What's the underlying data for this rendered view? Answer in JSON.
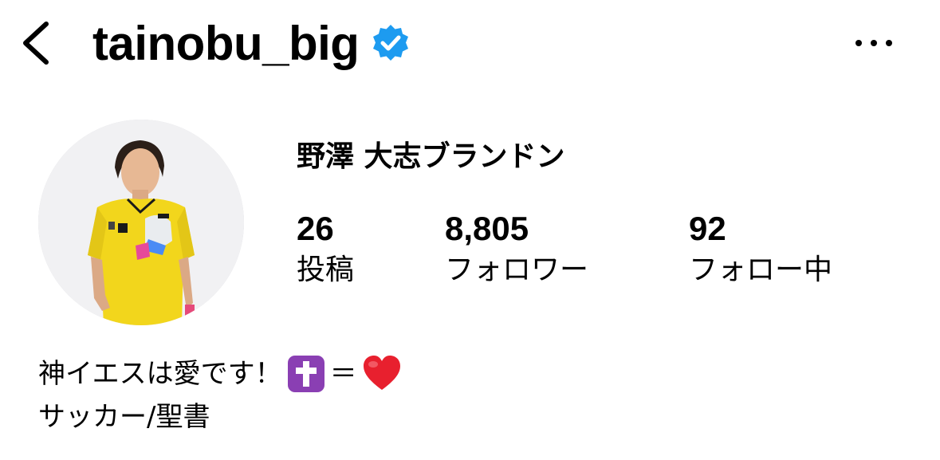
{
  "header": {
    "back_icon": "chevron-left-icon",
    "username": "tainobu_big",
    "verified_icon": "verified-badge-icon",
    "verified_color": "#1d9bf0",
    "more_icon": "more-horizontal-icon"
  },
  "profile": {
    "display_name": "野澤 大志ブランドン",
    "stats": [
      {
        "count": "26",
        "label": "投稿"
      },
      {
        "count": "8,805",
        "label": "フォロワー"
      },
      {
        "count": "92",
        "label": "フォロー中"
      }
    ],
    "avatar_icon": "profile-photo-avatar"
  },
  "bio": {
    "line1_text": "神イエスは愛です！",
    "cross_emoji": "latin-cross-emoji-icon",
    "equals": "＝",
    "heart_emoji": "red-heart-emoji-icon",
    "line2_text": "サッカー/聖書"
  }
}
